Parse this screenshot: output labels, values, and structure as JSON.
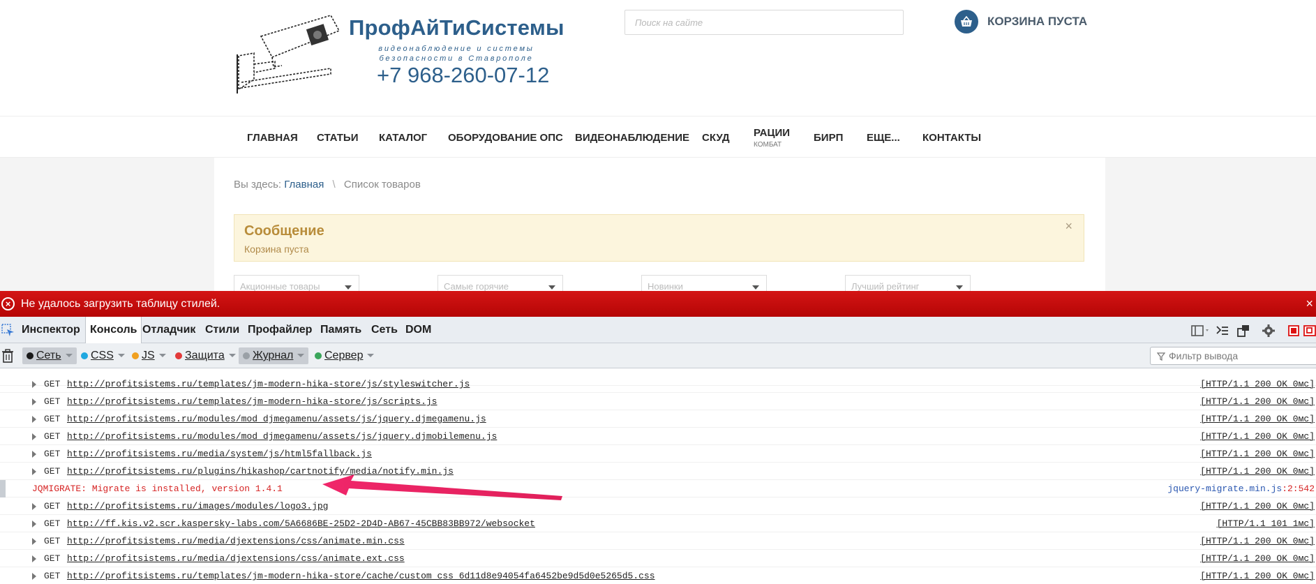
{
  "site": {
    "brand_name": "ПрофАйТиСистемы",
    "tagline_1": "видеонаблюдение и системы",
    "tagline_2": "безопасности в Ставрополе",
    "phone": "+7 968-260-07-12",
    "search_placeholder": "Поиск на сайте",
    "cart_label": "КОРЗИНА ПУСТА",
    "brand_color": "#2d5f8b"
  },
  "nav": {
    "items": [
      {
        "label": "ГЛАВНАЯ",
        "sub": ""
      },
      {
        "label": "СТАТЬИ",
        "sub": ""
      },
      {
        "label": "КАТАЛОГ",
        "sub": ""
      },
      {
        "label": "ОБОРУДОВАНИЕ ОПС",
        "sub": ""
      },
      {
        "label": "ВИДЕОНАБЛЮДЕНИЕ",
        "sub": ""
      },
      {
        "label": "СКУД",
        "sub": ""
      },
      {
        "label": "РАЦИИ",
        "sub": "КОМБАТ"
      },
      {
        "label": "БИРП",
        "sub": ""
      },
      {
        "label": "ЕЩЕ...",
        "sub": ""
      },
      {
        "label": "КОНТАКТЫ",
        "sub": ""
      }
    ]
  },
  "breadcrumb": {
    "prefix": "Вы здесь:",
    "home": "Главная",
    "separator": "\\",
    "current": "Список товаров"
  },
  "message": {
    "title": "Сообщение",
    "text": "Корзина пуста",
    "close": "×"
  },
  "filters": [
    "Акционные товары",
    "Самые горячие",
    "Новинки",
    "Лучший рейтинг"
  ],
  "error_banner": {
    "text": "Не удалось загрузить таблицу стилей.",
    "icon": "error-icon",
    "color": "#c40a0a"
  },
  "devtools": {
    "tabs": [
      "Инспектор",
      "Консоль",
      "Отладчик",
      "Стили",
      "Профайлер",
      "Память",
      "Сеть",
      "DOM"
    ],
    "active_tab": "Консоль",
    "filter_buttons": [
      {
        "label": "Сеть",
        "color": "#1a1a1a",
        "on": true
      },
      {
        "label": "CSS",
        "color": "#1fa8e0",
        "on": false
      },
      {
        "label": "JS",
        "color": "#f0a020",
        "on": false
      },
      {
        "label": "Защита",
        "color": "#e23a3a",
        "on": false
      },
      {
        "label": "Журнал",
        "color": "#9aa0a6",
        "on": true
      },
      {
        "label": "Сервер",
        "color": "#3aa55a",
        "on": false
      }
    ],
    "filter_placeholder": "Фильтр вывода"
  },
  "console": {
    "rows": [
      {
        "method": "GET",
        "url": "http://profitsistems.ru/templates/jm-modern-hika-store/js/styleswitcher.js",
        "status": "[HTTP/1.1 200 OK 0мс]"
      },
      {
        "method": "GET",
        "url": "http://profitsistems.ru/templates/jm-modern-hika-store/js/scripts.js",
        "status": "[HTTP/1.1 200 OK 0мс]"
      },
      {
        "method": "GET",
        "url": "http://profitsistems.ru/modules/mod_djmegamenu/assets/js/jquery.djmegamenu.js",
        "status": "[HTTP/1.1 200 OK 0мс]"
      },
      {
        "method": "GET",
        "url": "http://profitsistems.ru/modules/mod_djmegamenu/assets/js/jquery.djmobilemenu.js",
        "status": "[HTTP/1.1 200 OK 0мс]"
      },
      {
        "method": "GET",
        "url": "http://profitsistems.ru/media/system/js/html5fallback.js",
        "status": "[HTTP/1.1 200 OK 0мс]"
      },
      {
        "method": "GET",
        "url": "http://profitsistems.ru/plugins/hikashop/cartnotify/media/notify.min.js",
        "status": "[HTTP/1.1 200 OK 0мс]"
      }
    ],
    "warning": {
      "text": "JQMIGRATE: Migrate is installed, version 1.4.1",
      "source_file": "jquery-migrate.min.js",
      "source_line": ":2:542",
      "color": "#d62424"
    },
    "rows_after": [
      {
        "method": "GET",
        "url": "http://profitsistems.ru/images/modules/logo3.jpg",
        "status": "[HTTP/1.1 200 OK 0мс]"
      },
      {
        "method": "GET",
        "url": "http://ff.kis.v2.scr.kaspersky-labs.com/5A6686BE-25D2-2D4D-AB67-45CBB83BB972/websocket",
        "status": "[HTTP/1.1 101  1мс]"
      },
      {
        "method": "GET",
        "url": "http://profitsistems.ru/media/djextensions/css/animate.min.css",
        "status": "[HTTP/1.1 200 OK 0мс]"
      },
      {
        "method": "GET",
        "url": "http://profitsistems.ru/media/djextensions/css/animate.ext.css",
        "status": "[HTTP/1.1 200 OK 0мс]"
      },
      {
        "method": "GET",
        "url": "http://profitsistems.ru/templates/jm-modern-hika-store/cache/custom_css_6d11d8e94054fa6452be9d5d0e5265d5.css",
        "status": "[HTTP/1.1 200 OK 0мс]"
      }
    ],
    "arrow_color": "#f0266a"
  }
}
